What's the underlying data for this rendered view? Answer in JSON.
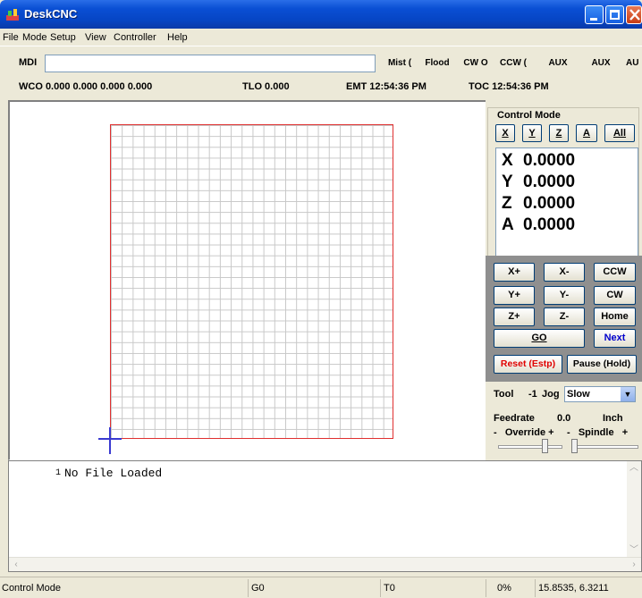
{
  "window": {
    "title": "DeskCNC"
  },
  "menu": [
    "File",
    "Mode",
    "Setup",
    "View",
    "Controller",
    "Help"
  ],
  "toolbar": {
    "mdi_label": "MDI",
    "mdi_value": "",
    "buttons": [
      "Mist (",
      "Flood",
      "CW O",
      "CCW (",
      "AUX",
      "AUX",
      "AU"
    ]
  },
  "status_row": {
    "wco": "WCO  0.000  0.000  0.000  0.000",
    "tlo": "TLO  0.000",
    "emt": "EMT  12:54:36 PM",
    "toc": "TOC  12:54:36 PM"
  },
  "control": {
    "legend": "Control Mode",
    "axis_buttons": [
      "X",
      "Y",
      "Z",
      "A",
      "All"
    ],
    "dro": [
      {
        "axis": "X",
        "value": "0.0000"
      },
      {
        "axis": "Y",
        "value": "0.0000"
      },
      {
        "axis": "Z",
        "value": "0.0000"
      },
      {
        "axis": "A",
        "value": "0.0000"
      }
    ]
  },
  "jog": {
    "buttons": [
      "X+",
      "X-",
      "CCW",
      "Y+",
      "Y-",
      "CW",
      "Z+",
      "Z-",
      "Home"
    ],
    "go": "GO",
    "next": "Next",
    "reset": "Reset (Estp)",
    "pause": "Pause (Hold)",
    "colors": {
      "next": "#0000cc",
      "reset": "#e00000"
    }
  },
  "settings": {
    "tool_label": "Tool",
    "tool_value": "-1",
    "jog_label": "Jog",
    "jog_value": "Slow",
    "feedrate_label": "Feedrate",
    "feedrate_value": "0.0",
    "units": "Inch",
    "override_label": "-   Override +",
    "spindle_label": "-   Spindle   +"
  },
  "code": {
    "line_number": "1",
    "text": "No File Loaded"
  },
  "statusbar": {
    "mode": "Control Mode",
    "gcode": "G0",
    "tool": "T0",
    "percent": "0%",
    "coords": "15.8535, 6.3211"
  }
}
